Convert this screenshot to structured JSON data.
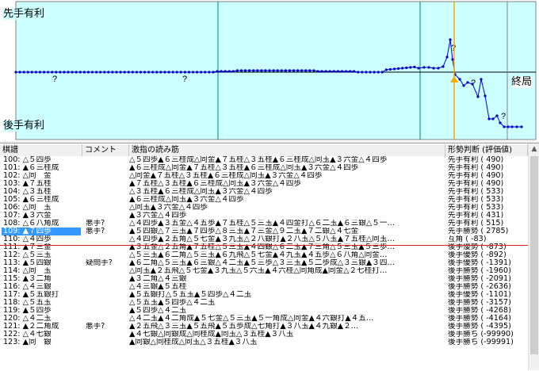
{
  "graph": {
    "label_top": "先手有利",
    "label_bottom": "後手有利",
    "label_end": "終局",
    "markers": [
      "?",
      "?",
      "?",
      "?",
      "?"
    ],
    "colors": {
      "background": "#ccffff",
      "line": "#0000cc",
      "cursor": "#ffa500",
      "grid": "#008080"
    }
  },
  "columns": [
    "棋譜",
    "コメント",
    "激指の読み筋",
    "形勢判断 (評価値)"
  ],
  "rows": [
    {
      "move": "100: △５四歩",
      "comment": "",
      "pv": "△５四歩▲６三桂成△同金▲７五桂△３五桂▲６三桂成△同玉▲３六金△４四歩",
      "eval": "先手有利 (   490)"
    },
    {
      "move": "101: ▲６三桂成",
      "comment": "",
      "pv": "▲６三桂成△同金▲７五桂△３五桂▲６三桂成△同玉▲３六金△４四歩",
      "eval": "先手有利 (   490)"
    },
    {
      "move": "102: △同　金",
      "comment": "",
      "pv": "△同金▲７五桂△３五桂▲６三桂成△同玉▲３六金△４四歩",
      "eval": "先手有利 (   490)"
    },
    {
      "move": "103: ▲７五桂",
      "comment": "",
      "pv": "▲７五桂△３五桂▲６三桂成△同玉▲３六金△４四歩",
      "eval": "先手有利 (   490)"
    },
    {
      "move": "104: △３五桂",
      "comment": "",
      "pv": "△３五桂▲６三桂成△同玉▲３六金△４四歩",
      "eval": "先手有利 (   533)"
    },
    {
      "move": "105: ▲６三桂成",
      "comment": "",
      "pv": "▲６三桂成△同玉▲３六金△４四歩",
      "eval": "先手有利 (   533)"
    },
    {
      "move": "106: △同　玉",
      "comment": "",
      "pv": "△同玉▲３六金△４四歩",
      "eval": "先手有利 (   533)"
    },
    {
      "move": "107: ▲３六金",
      "comment": "",
      "pv": "▲３六金△４四歩",
      "eval": "先手有利 (   431)"
    },
    {
      "move": "108: △６八角成",
      "comment": "悪手?",
      "pv": "△４四歩▲３五金△４五歩▲７五桂△５三玉▲４四金打△６二玉▲６三銀△５一…",
      "eval": "先手有利 (   515)"
    },
    {
      "move": "109: ▲７四歩",
      "comment": "悪手?",
      "pv": "▲５四銀△７三玉▲７四歩△８三玉▲７三金△９二玉▲７二銀△４七金",
      "eval": "先手勝勢 (  2785)",
      "selected": true
    },
    {
      "move": "110: △４四歩",
      "comment": "",
      "pv": "△４四歩▲２五角△５七金▲３九玉△２八銀打▲２八玉△５八玉▲７五桂△同玉…",
      "eval": "互角     (   -83)"
    },
    {
      "move": "111: ▲７三金",
      "comment": "",
      "pv": "▲３五金△２五角▲７五桂△５三玉▲４四銀△６二玉▲７三角△５三玉▲５三歩…",
      "eval": "後手優勢 (  -873)"
    },
    {
      "move": "112: △５三玉",
      "comment": "",
      "pv": "△５三玉▲６二角△５三玉▲６九飛△５七金▲４九玉▲４五歩△６八角△同金…",
      "eval": "後手優勢 (  -892)"
    },
    {
      "move": "113: ▲５四銀",
      "comment": "疑問手?",
      "pv": "▲６二角△５三玉▲６三銀△４二玉▲５三歩△３三玉▲５二歩成△３三銀▲３四…",
      "eval": "後手優勢 ( -1391)"
    },
    {
      "move": "114: △同　玉",
      "comment": "",
      "pv": "△同玉▲２五飛△５七金▲３九玉△５六玉▲４六桂△同角成▲同金△２七桂打…",
      "eval": "後手勝勢 ( -1960)"
    },
    {
      "move": "115: ▲３二角",
      "comment": "",
      "pv": "▲３二角△４三銀",
      "eval": "後手勝勢 ( -2091)"
    },
    {
      "move": "116: △４三銀",
      "comment": "",
      "pv": "△４三銀▲５五桂",
      "eval": "後手勝勢 ( -2636)"
    },
    {
      "move": "117: ▲５五銀打",
      "comment": "",
      "pv": "▲５五銀打△５五玉▲５四歩△４二玉",
      "eval": "後手優勢 ( -1101)"
    },
    {
      "move": "118: △５五玉",
      "comment": "",
      "pv": "△５五玉▲５四歩△４二玉",
      "eval": "後手勝勢 ( -3157)"
    },
    {
      "move": "119: ▲５四歩",
      "comment": "",
      "pv": "▲５四歩△４二玉",
      "eval": "後手勝勢 ( -4268)"
    },
    {
      "move": "120: △４二玉",
      "comment": "",
      "pv": "△４二玉▲４二角成▲５七金△５三玉▲５一角成△同金▲４六銀打▲４五…",
      "eval": "後手勝勢 ( -4164)"
    },
    {
      "move": "121: ▲２二角成",
      "comment": "悪手?",
      "pv": "▲２五飛△３三玉▲５五飛▲５五歩成△七角打▲３八玉▲４九銀▲２…",
      "eval": "後手勝勢 ( -4395)"
    },
    {
      "move": "122: △４七銀",
      "comment": "",
      "pv": "▲４七銀△同銀成△同桂成▲同玉△３五桂▲３八玉",
      "eval": "後手勝ち (-99990)"
    },
    {
      "move": "123: ▲同　銀",
      "comment": "",
      "pv": "▲同銀△同桂成△同玉△３五桂▲３八玉",
      "eval": "後手勝ち (-99991)"
    }
  ]
}
